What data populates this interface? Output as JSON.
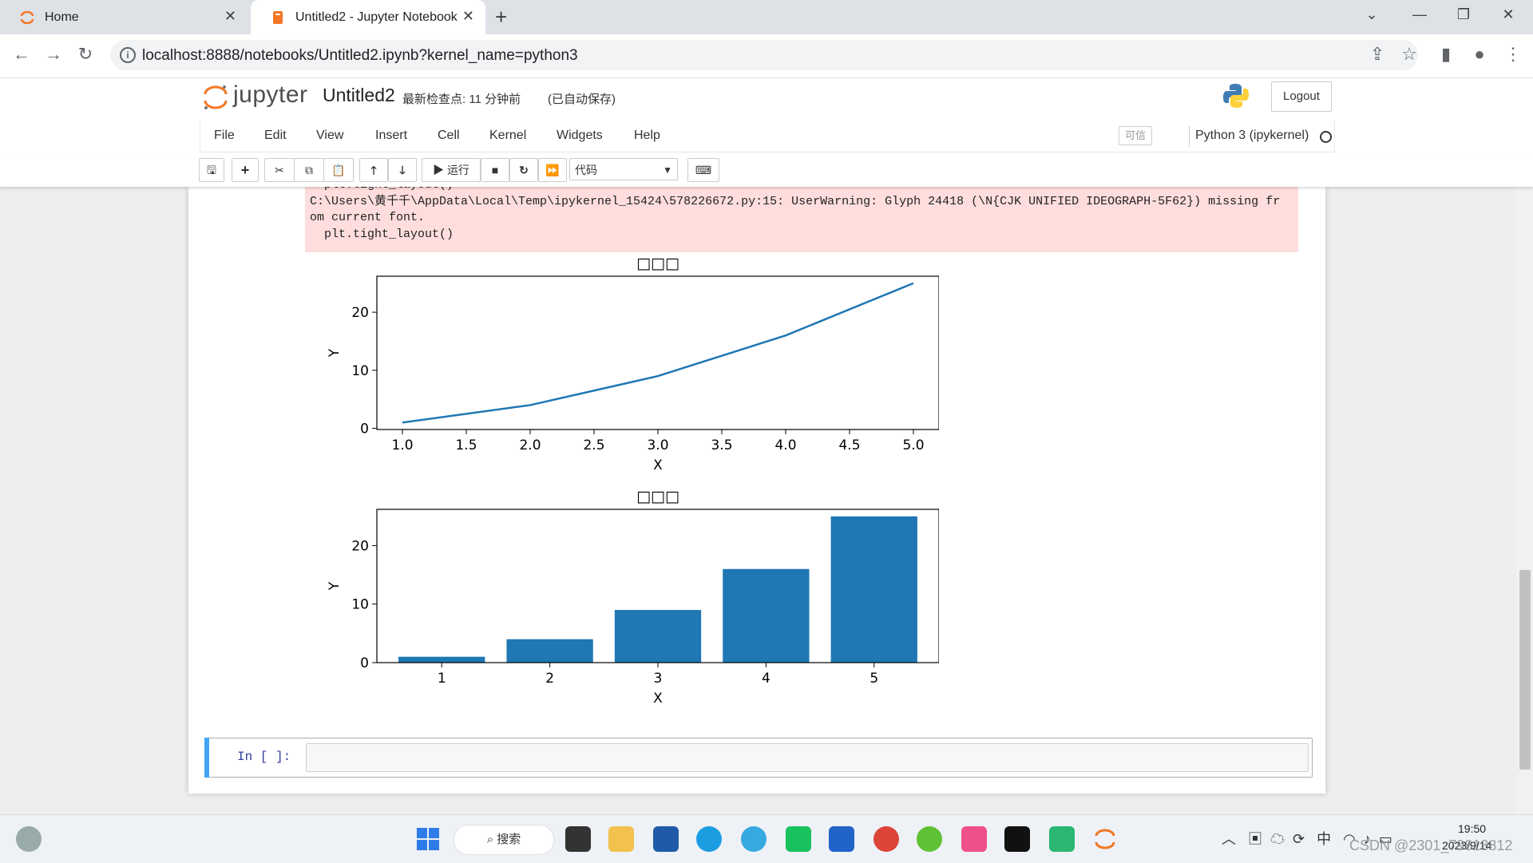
{
  "browser": {
    "tabs": [
      {
        "title": "Home"
      },
      {
        "title": "Untitled2 - Jupyter Notebook"
      }
    ],
    "url": "localhost:8888/notebooks/Untitled2.ipynb?kernel_name=python3"
  },
  "jupyter": {
    "logo_text": "jupyter",
    "notebook_name": "Untitled2",
    "checkpoint": "最新检查点: 11 分钟前",
    "autosave": "(已自动保存)",
    "logout": "Logout",
    "menu": [
      "File",
      "Edit",
      "View",
      "Insert",
      "Cell",
      "Kernel",
      "Widgets",
      "Help"
    ],
    "trusted": "可信",
    "kernel": "Python 3 (ipykernel)",
    "toolbar": {
      "run_label": "运行",
      "cell_type": "代码"
    }
  },
  "output": {
    "stderr": [
      "  plt.tight_layout()",
      "C:\\Users\\黄千千\\AppData\\Local\\Temp\\ipykernel_15424\\578226672.py:15: UserWarning: Glyph 24418 (\\N{CJK UNIFIED IDEOGRAPH-5F62}) missing fr",
      "om current font.",
      "  plt.tight_layout()"
    ]
  },
  "chart_data": [
    {
      "type": "line",
      "title": "□□□",
      "xlabel": "X",
      "ylabel": "Y",
      "x": [
        1,
        2,
        3,
        4,
        5
      ],
      "y": [
        1,
        4,
        9,
        16,
        25
      ],
      "xticks": [
        "1.0",
        "1.5",
        "2.0",
        "2.5",
        "3.0",
        "3.5",
        "4.0",
        "4.5",
        "5.0"
      ],
      "yticks": [
        "0",
        "10",
        "20"
      ],
      "xlim": [
        0.8,
        5.2
      ],
      "ylim": [
        -0.2,
        26.2
      ],
      "color": "#1f77b4"
    },
    {
      "type": "bar",
      "title": "□□□",
      "xlabel": "X",
      "ylabel": "Y",
      "categories": [
        "1",
        "2",
        "3",
        "4",
        "5"
      ],
      "values": [
        1,
        4,
        9,
        16,
        25
      ],
      "yticks": [
        "0",
        "10",
        "20"
      ],
      "ylim": [
        0,
        26.2
      ],
      "color": "#1f77b4"
    }
  ],
  "cell": {
    "prompt": "In [ ]:"
  },
  "taskbar": {
    "search": "搜索",
    "ime": "中",
    "time": "19:50",
    "date": "2023/9/14",
    "watermark": "CSDN @2301_79813812"
  }
}
